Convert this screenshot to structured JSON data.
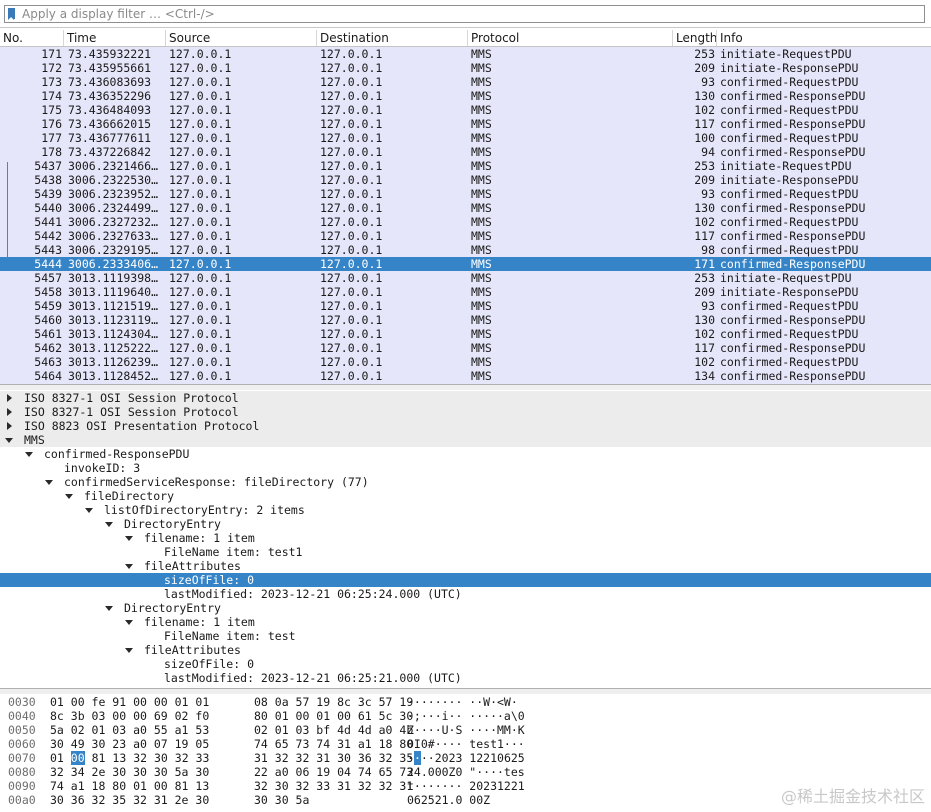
{
  "filter": {
    "placeholder": "Apply a display filter … <Ctrl-/>"
  },
  "columns": [
    "No.",
    "Time",
    "Source",
    "Destination",
    "Protocol",
    "Length",
    "Info"
  ],
  "packets": [
    {
      "no": "171",
      "time": "73.435932221",
      "src": "127.0.0.1",
      "dst": "127.0.0.1",
      "proto": "MMS",
      "len": "253",
      "info": "initiate-RequestPDU"
    },
    {
      "no": "172",
      "time": "73.435955661",
      "src": "127.0.0.1",
      "dst": "127.0.0.1",
      "proto": "MMS",
      "len": "209",
      "info": "initiate-ResponsePDU"
    },
    {
      "no": "173",
      "time": "73.436083693",
      "src": "127.0.0.1",
      "dst": "127.0.0.1",
      "proto": "MMS",
      "len": "93",
      "info": "confirmed-RequestPDU"
    },
    {
      "no": "174",
      "time": "73.436352296",
      "src": "127.0.0.1",
      "dst": "127.0.0.1",
      "proto": "MMS",
      "len": "130",
      "info": "confirmed-ResponsePDU"
    },
    {
      "no": "175",
      "time": "73.436484093",
      "src": "127.0.0.1",
      "dst": "127.0.0.1",
      "proto": "MMS",
      "len": "102",
      "info": "confirmed-RequestPDU"
    },
    {
      "no": "176",
      "time": "73.436662015",
      "src": "127.0.0.1",
      "dst": "127.0.0.1",
      "proto": "MMS",
      "len": "117",
      "info": "confirmed-ResponsePDU"
    },
    {
      "no": "177",
      "time": "73.436777611",
      "src": "127.0.0.1",
      "dst": "127.0.0.1",
      "proto": "MMS",
      "len": "100",
      "info": "confirmed-RequestPDU"
    },
    {
      "no": "178",
      "time": "73.437226842",
      "src": "127.0.0.1",
      "dst": "127.0.0.1",
      "proto": "MMS",
      "len": "94",
      "info": "confirmed-ResponsePDU"
    },
    {
      "no": "5437",
      "time": "3006.2321466…",
      "src": "127.0.0.1",
      "dst": "127.0.0.1",
      "proto": "MMS",
      "len": "253",
      "info": "initiate-RequestPDU"
    },
    {
      "no": "5438",
      "time": "3006.2322530…",
      "src": "127.0.0.1",
      "dst": "127.0.0.1",
      "proto": "MMS",
      "len": "209",
      "info": "initiate-ResponsePDU"
    },
    {
      "no": "5439",
      "time": "3006.2323952…",
      "src": "127.0.0.1",
      "dst": "127.0.0.1",
      "proto": "MMS",
      "len": "93",
      "info": "confirmed-RequestPDU"
    },
    {
      "no": "5440",
      "time": "3006.2324499…",
      "src": "127.0.0.1",
      "dst": "127.0.0.1",
      "proto": "MMS",
      "len": "130",
      "info": "confirmed-ResponsePDU"
    },
    {
      "no": "5441",
      "time": "3006.2327232…",
      "src": "127.0.0.1",
      "dst": "127.0.0.1",
      "proto": "MMS",
      "len": "102",
      "info": "confirmed-RequestPDU"
    },
    {
      "no": "5442",
      "time": "3006.2327633…",
      "src": "127.0.0.1",
      "dst": "127.0.0.1",
      "proto": "MMS",
      "len": "117",
      "info": "confirmed-ResponsePDU"
    },
    {
      "no": "5443",
      "time": "3006.2329195…",
      "src": "127.0.0.1",
      "dst": "127.0.0.1",
      "proto": "MMS",
      "len": "98",
      "info": "confirmed-RequestPDU"
    },
    {
      "no": "5444",
      "time": "3006.2333406…",
      "src": "127.0.0.1",
      "dst": "127.0.0.1",
      "proto": "MMS",
      "len": "171",
      "info": "confirmed-ResponsePDU",
      "selected": true
    },
    {
      "no": "5457",
      "time": "3013.1119398…",
      "src": "127.0.0.1",
      "dst": "127.0.0.1",
      "proto": "MMS",
      "len": "253",
      "info": "initiate-RequestPDU"
    },
    {
      "no": "5458",
      "time": "3013.1119640…",
      "src": "127.0.0.1",
      "dst": "127.0.0.1",
      "proto": "MMS",
      "len": "209",
      "info": "initiate-ResponsePDU"
    },
    {
      "no": "5459",
      "time": "3013.1121519…",
      "src": "127.0.0.1",
      "dst": "127.0.0.1",
      "proto": "MMS",
      "len": "93",
      "info": "confirmed-RequestPDU"
    },
    {
      "no": "5460",
      "time": "3013.1123119…",
      "src": "127.0.0.1",
      "dst": "127.0.0.1",
      "proto": "MMS",
      "len": "130",
      "info": "confirmed-ResponsePDU"
    },
    {
      "no": "5461",
      "time": "3013.1124304…",
      "src": "127.0.0.1",
      "dst": "127.0.0.1",
      "proto": "MMS",
      "len": "102",
      "info": "confirmed-RequestPDU"
    },
    {
      "no": "5462",
      "time": "3013.1125222…",
      "src": "127.0.0.1",
      "dst": "127.0.0.1",
      "proto": "MMS",
      "len": "117",
      "info": "confirmed-ResponsePDU"
    },
    {
      "no": "5463",
      "time": "3013.1126239…",
      "src": "127.0.0.1",
      "dst": "127.0.0.1",
      "proto": "MMS",
      "len": "102",
      "info": "confirmed-RequestPDU"
    },
    {
      "no": "5464",
      "time": "3013.1128452…",
      "src": "127.0.0.1",
      "dst": "127.0.0.1",
      "proto": "MMS",
      "len": "134",
      "info": "confirmed-ResponsePDU"
    }
  ],
  "details": [
    {
      "depth": 0,
      "toggle": "collapsed",
      "text": "ISO 8327-1 OSI Session Protocol",
      "bg": "gray"
    },
    {
      "depth": 0,
      "toggle": "collapsed",
      "text": "ISO 8327-1 OSI Session Protocol",
      "bg": "gray"
    },
    {
      "depth": 0,
      "toggle": "collapsed",
      "text": "ISO 8823 OSI Presentation Protocol",
      "bg": "gray"
    },
    {
      "depth": 0,
      "toggle": "expanded",
      "text": "MMS",
      "bg": "gray"
    },
    {
      "depth": 1,
      "toggle": "expanded",
      "text": "confirmed-ResponsePDU"
    },
    {
      "depth": 2,
      "toggle": "none",
      "text": "invokeID: 3"
    },
    {
      "depth": 2,
      "toggle": "expanded",
      "text": "confirmedServiceResponse: fileDirectory (77)"
    },
    {
      "depth": 3,
      "toggle": "expanded",
      "text": "fileDirectory"
    },
    {
      "depth": 4,
      "toggle": "expanded",
      "text": "listOfDirectoryEntry: 2 items"
    },
    {
      "depth": 5,
      "toggle": "expanded",
      "text": "DirectoryEntry"
    },
    {
      "depth": 6,
      "toggle": "expanded",
      "text": "filename: 1 item"
    },
    {
      "depth": 7,
      "toggle": "none",
      "text": "FileName item: test1"
    },
    {
      "depth": 6,
      "toggle": "expanded",
      "text": "fileAttributes"
    },
    {
      "depth": 7,
      "toggle": "none",
      "text": "sizeOfFile: 0",
      "selected": true
    },
    {
      "depth": 7,
      "toggle": "none",
      "text": "lastModified: 2023-12-21 06:25:24.000 (UTC)"
    },
    {
      "depth": 5,
      "toggle": "expanded",
      "text": "DirectoryEntry"
    },
    {
      "depth": 6,
      "toggle": "expanded",
      "text": "filename: 1 item"
    },
    {
      "depth": 7,
      "toggle": "none",
      "text": "FileName item: test"
    },
    {
      "depth": 6,
      "toggle": "expanded",
      "text": "fileAttributes"
    },
    {
      "depth": 7,
      "toggle": "none",
      "text": "sizeOfFile: 0"
    },
    {
      "depth": 7,
      "toggle": "none",
      "text": "lastModified: 2023-12-21 06:25:21.000 (UTC)"
    }
  ],
  "hex": [
    {
      "off": "0030",
      "b1": "01 00 fe 91 00 00 01 01",
      "b2": "08 0a 57 19 8c 3c 57 19",
      "ascii": "········ ··W·<W·"
    },
    {
      "off": "0040",
      "b1": "8c 3b 03 00 00 69 02 f0",
      "b2": "80 01 00 01 00 61 5c 30",
      "ascii": "·;···i·· ·····a\\0"
    },
    {
      "off": "0050",
      "b1": "5a 02 01 03 a0 55 a1 53",
      "b2": "02 01 03 bf 4d 4d a0 4b",
      "ascii": "Z····U·S ····MM·K"
    },
    {
      "off": "0060",
      "b1": "30 49 30 23 a0 07 19 05",
      "b2": "74 65 73 74 31 a1 18 80",
      "ascii": "0I0#···· test1···"
    },
    {
      "off": "0070",
      "b1": "01 00 81 13 32 30 32 33",
      "b2": "31 32 32 31 30 36 32 35",
      "ascii": "····2023 12210625",
      "hl": true
    },
    {
      "off": "0080",
      "b1": "32 34 2e 30 30 30 5a 30",
      "b2": "22 a0 06 19 04 74 65 73",
      "ascii": "24.000Z0 \"····tes"
    },
    {
      "off": "0090",
      "b1": "74 a1 18 80 01 00 81 13",
      "b2": "32 30 32 33 31 32 32 31",
      "ascii": "t······· 20231221"
    },
    {
      "off": "00a0",
      "b1": "30 36 32 35 32 31 2e 30",
      "b2": "30 30 5a",
      "ascii": "062521.0 00Z"
    }
  ],
  "watermark": "@稀土掘金技术社区"
}
